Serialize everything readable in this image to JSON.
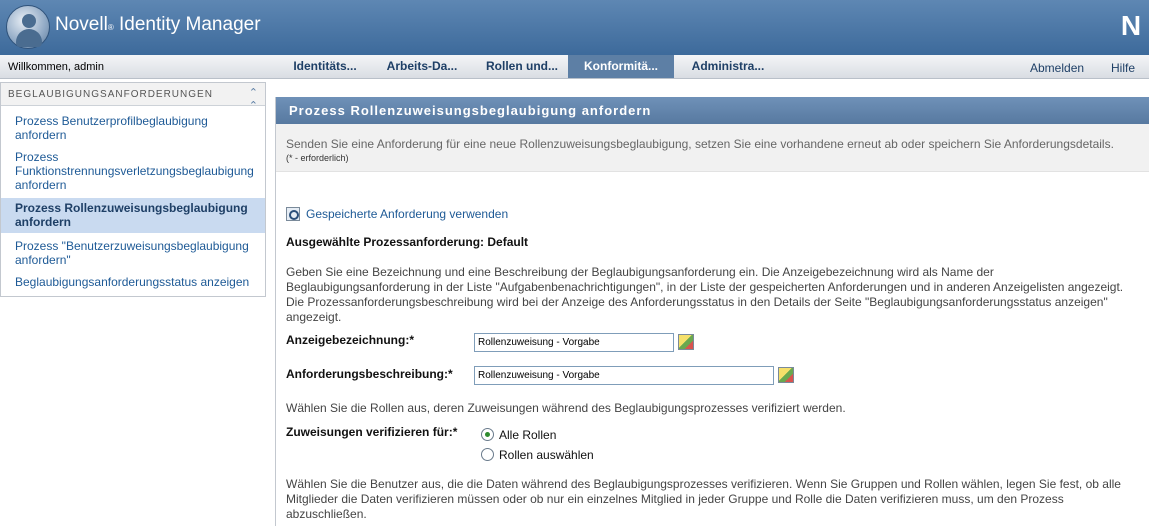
{
  "header": {
    "app_name": "Novell",
    "reg_mark": "®",
    "app_product": " Identity Manager",
    "brand_letter": "N"
  },
  "nav": {
    "welcome": "Willkommen, admin",
    "tabs": [
      {
        "label": "Identitäts..."
      },
      {
        "label": "Arbeits-Da..."
      },
      {
        "label": "Rollen und..."
      },
      {
        "label": "Konformitä...",
        "active": true
      },
      {
        "label": "Administra..."
      }
    ],
    "logout": "Abmelden",
    "help": "Hilfe"
  },
  "sidebar": {
    "title": "BEGLAUBIGUNGSANFORDERUNGEN",
    "items": [
      {
        "label": "Prozess Benutzerprofilbeglaubigung anfordern"
      },
      {
        "label": "Prozess Funktionstrennungsverletzungsbeglaubigung anfordern"
      },
      {
        "label": "Prozess Rollenzuweisungsbeglaubigung anfordern",
        "selected": true
      },
      {
        "label": "Prozess \"Benutzerzuweisungsbeglaubigung anfordern\""
      },
      {
        "label": "Beglaubigungsanforderungsstatus anzeigen"
      }
    ]
  },
  "panel": {
    "title": "Prozess Rollenzuweisungsbeglaubigung anfordern",
    "description": "Senden Sie eine Anforderung für eine neue Rollenzuweisungsbeglaubigung, setzen Sie eine vorhandene erneut ab oder speichern Sie Anforderungsdetails.",
    "required_note": "(* - erforderlich)",
    "use_saved": "Gespeicherte Anforderung verwenden",
    "selected_request": "Ausgewählte Prozessanforderung: Default",
    "instructions": "Geben Sie eine Bezeichnung und eine Beschreibung der Beglaubigungsanforderung ein. Die Anzeigebezeichnung wird als Name der Beglaubigungsanforderung in der Liste \"Aufgabenbenachrichtigungen\", in der Liste der gespeicherten Anforderungen und in anderen Anzeigelisten angezeigt. Die Prozessanforderungsbeschreibung wird bei der Anzeige des Anforderungsstatus in den Details der Seite \"Beglaubigungsanforderungsstatus anzeigen\" angezeigt.",
    "display_label": "Anzeigebezeichnung:*",
    "display_value": "Rollenzuweisung - Vorgabe",
    "desc_label": "Anforderungsbeschreibung:*",
    "desc_value": "Rollenzuweisung - Vorgabe",
    "roles_instruction": "Wählen Sie die Rollen aus, deren Zuweisungen während des Beglaubigungsprozesses verifiziert werden.",
    "verify_label": "Zuweisungen verifizieren für:*",
    "radio_all": "Alle Rollen",
    "radio_select": "Rollen auswählen",
    "users_instruction": "Wählen Sie die Benutzer aus, die die Daten während des Beglaubigungsprozesses verifizieren. Wenn Sie Gruppen und Rollen wählen, legen Sie fest, ob alle Mitglieder die Daten verifizieren müssen oder ob nur ein einzelnes Mitglied in jeder Gruppe und Rolle die Daten verifizieren muss, um den Prozess abzuschließen."
  }
}
